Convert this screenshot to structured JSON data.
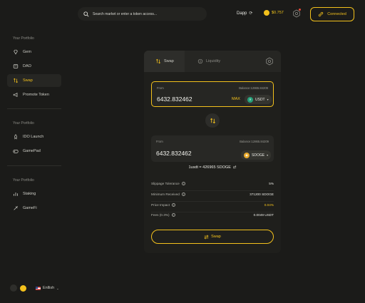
{
  "header": {
    "search_placeholder": "Search market or enter a token access...",
    "network": "Dapp",
    "balance": "$0.757",
    "connect_label": "Connected"
  },
  "sidebar": {
    "sections": [
      {
        "title": "Your Portfolio",
        "items": [
          {
            "label": "Gem",
            "icon": "diamond-icon"
          },
          {
            "label": "DAO",
            "icon": "dao-icon"
          },
          {
            "label": "Swap",
            "icon": "swap-icon",
            "active": true
          },
          {
            "label": "Promote Token",
            "icon": "megaphone-icon"
          }
        ]
      },
      {
        "title": "Your Portfolio",
        "items": [
          {
            "label": "IDO Launch",
            "icon": "rocket-icon"
          },
          {
            "label": "GamePad",
            "icon": "gamepad-icon"
          }
        ]
      },
      {
        "title": "Your Portfolio",
        "items": [
          {
            "label": "Staking",
            "icon": "staking-icon"
          },
          {
            "label": "GameFi",
            "icon": "gamefi-icon"
          }
        ]
      }
    ],
    "language": "Enllish"
  },
  "swap": {
    "tabs": {
      "swap": "Swap",
      "liquidity": "Liquidity"
    },
    "from_label": "From",
    "from_balance": "Balance:12865.84209",
    "from_amount": "6432.832462",
    "max_label": "MAX",
    "from_token": "USDT",
    "to_label": "From",
    "to_balance": "Balance:12865.84209",
    "to_amount": "6432.832462",
    "to_token": "SDOGE",
    "rate": "1usdt = 426965 SDOGE",
    "details": [
      {
        "label": "Slippage Tolerance",
        "value": "5%",
        "highlight": false
      },
      {
        "label": "Minimum Received",
        "value": "371200 SDOGE",
        "highlight": false
      },
      {
        "label": "Price Impact",
        "value": "0.04%",
        "highlight": true
      },
      {
        "label": "Fees (0.3%)",
        "value": "0.0049 USDT",
        "highlight": false
      }
    ],
    "button_label": "Swap"
  },
  "colors": {
    "accent": "#f3c11c",
    "background": "#1b1b19",
    "panel": "#1f1f1c"
  }
}
